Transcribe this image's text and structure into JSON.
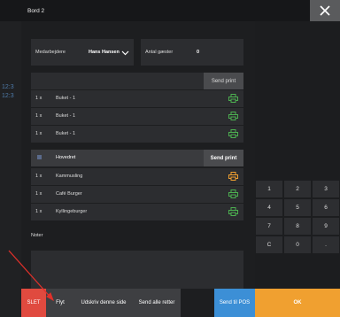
{
  "background": {
    "times": [
      "12:3",
      "12:3"
    ],
    "keypad": [
      "1",
      "2",
      "3",
      "4",
      "5",
      "6",
      "7",
      "8",
      "9",
      "C",
      "0",
      "."
    ]
  },
  "dialog": {
    "title": "Bord 2",
    "close_icon": "close-icon",
    "employee_label": "Medarbejdere",
    "employee_value": "Hans Hansen",
    "guests_label": "Antal gæster",
    "guests_value": "0",
    "section1": {
      "send_label": "Send print",
      "items": [
        {
          "qty": "1 x",
          "name": "Buket - 1",
          "icon": "printer-icon",
          "color": "#4caf50"
        },
        {
          "qty": "1 x",
          "name": "Buket - 1",
          "icon": "printer-icon",
          "color": "#4caf50"
        },
        {
          "qty": "1 x",
          "name": "Buket - 1",
          "icon": "printer-icon",
          "color": "#4caf50"
        }
      ]
    },
    "section2": {
      "header": "Hovedret",
      "send_label": "Send print",
      "items": [
        {
          "qty": "1 x",
          "name": "Kammusling",
          "icon": "printer-icon",
          "color": "#f0a030"
        },
        {
          "qty": "1 x",
          "name": "Café Burger",
          "icon": "printer-icon",
          "color": "#4caf50"
        },
        {
          "qty": "1 x",
          "name": "Kyllingeburger",
          "icon": "printer-icon",
          "color": "#4caf50"
        }
      ]
    },
    "notes_label": "Noter"
  },
  "bottom_bar": {
    "delete": "SLET",
    "move": "Flyt",
    "print_page": "Udskriv denne side",
    "send_all": "Send alle retter",
    "send_pos": "Send til POS",
    "ok": "OK"
  },
  "colors": {
    "delete": "#e04a3f",
    "send_pos": "#3c8fd6",
    "ok": "#f0a030",
    "arrow": "#e0302a"
  }
}
